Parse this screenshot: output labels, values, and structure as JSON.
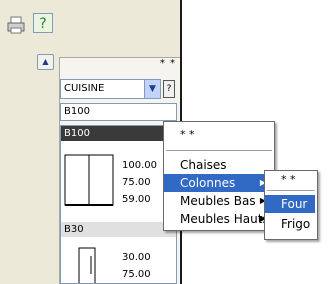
{
  "toolbar": {
    "print_icon": "printer-icon",
    "help_icon": "help-icon",
    "help_glyph": "?"
  },
  "panel": {
    "header": "* *",
    "scroll_up": "▲"
  },
  "category": {
    "value": "CUISINE",
    "arrow": "▼",
    "help": "?"
  },
  "code_input": {
    "value": "B100"
  },
  "list": {
    "items": [
      {
        "label": "B100",
        "dims": [
          "100.00",
          "75.00",
          "59.00"
        ]
      },
      {
        "label": "B30",
        "dims": [
          "30.00",
          "75.00"
        ]
      }
    ]
  },
  "context_menu": {
    "header": "* *",
    "items": [
      "Chaises",
      "Colonnes",
      "Meubles Bas",
      "Meubles Hauts"
    ],
    "submenu_arrow": "▶"
  },
  "submenu": {
    "header": "* *",
    "items": [
      "Four",
      "Frigo"
    ]
  },
  "colors": {
    "selection": "#316ac5",
    "panel_bg": "#ece9d8"
  }
}
